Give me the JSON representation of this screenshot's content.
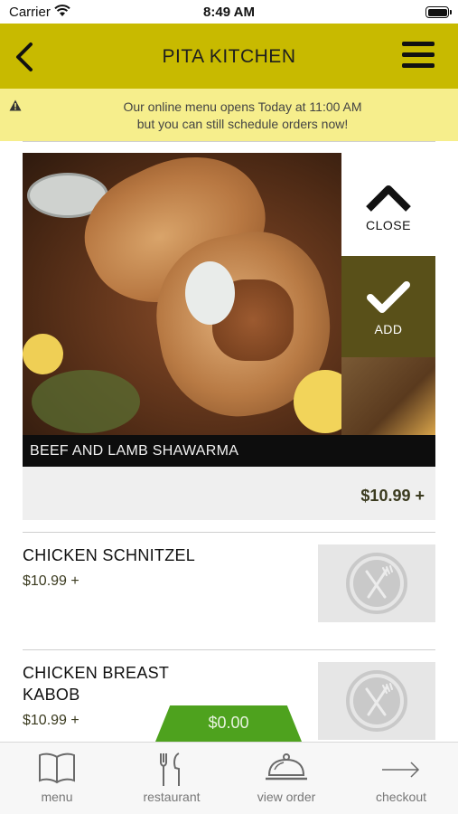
{
  "status_bar": {
    "carrier": "Carrier",
    "time": "8:49 AM"
  },
  "header": {
    "title": "PITA KITCHEN"
  },
  "notice": {
    "line1": "Our online menu opens Today at 11:00 AM",
    "line2": "but you can still schedule orders now!"
  },
  "featured_item": {
    "name": "BEEF AND LAMB SHAWARMA",
    "price": "$10.99 +",
    "close_label": "CLOSE",
    "add_label": "ADD"
  },
  "menu_items": [
    {
      "name_lines": [
        "CHICKEN SCHNITZEL"
      ],
      "price": "$10.99 +"
    },
    {
      "name_lines": [
        "CHICKEN BREAST",
        "KABOB"
      ],
      "price": "$10.99 +"
    }
  ],
  "cart": {
    "total": "$0.00"
  },
  "tabs": [
    {
      "label": "menu",
      "icon": "book-icon"
    },
    {
      "label": "restaurant",
      "icon": "fork-knife-icon"
    },
    {
      "label": "view order",
      "icon": "cloche-icon"
    },
    {
      "label": "checkout",
      "icon": "arrow-right-icon"
    }
  ],
  "colors": {
    "brand": "#c8ba00",
    "notice_bg": "#f6ee8c",
    "add_bg": "#595019",
    "cart_green": "#4ea21e"
  }
}
